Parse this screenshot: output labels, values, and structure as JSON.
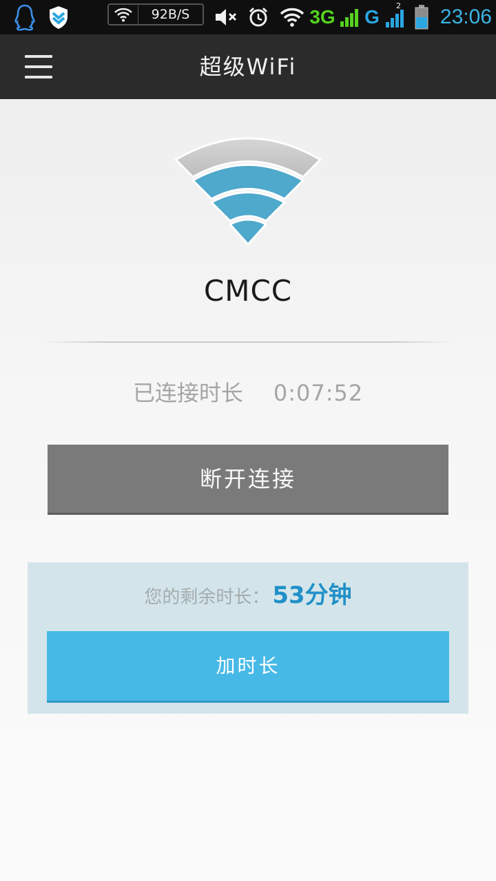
{
  "status_bar": {
    "speed": "92B/S",
    "network_3g": "3G",
    "network_g": "G",
    "sim2_label": "2",
    "time": "23:06",
    "icons": [
      "qq-penguin-icon",
      "shield-icon",
      "wifi-icon",
      "mute-icon",
      "alarm-icon",
      "wifi-icon",
      "signal-icon",
      "battery-icon"
    ]
  },
  "header": {
    "title": "超级WiFi",
    "menu_icon": "hamburger-menu-icon"
  },
  "main": {
    "ssid": "CMCC",
    "connected_label": "已连接时长",
    "connected_time": "0:07:52",
    "disconnect_label": "断开连接"
  },
  "remaining": {
    "label": "您的剩余时长：",
    "value": "53分钟",
    "add_label": "加时长"
  },
  "colors": {
    "accent": "#47b9e6",
    "wifi_blue": "#4fa9cc",
    "panel_bg": "#d3e5ea",
    "disconnect_bg": "#7a7a7a"
  }
}
